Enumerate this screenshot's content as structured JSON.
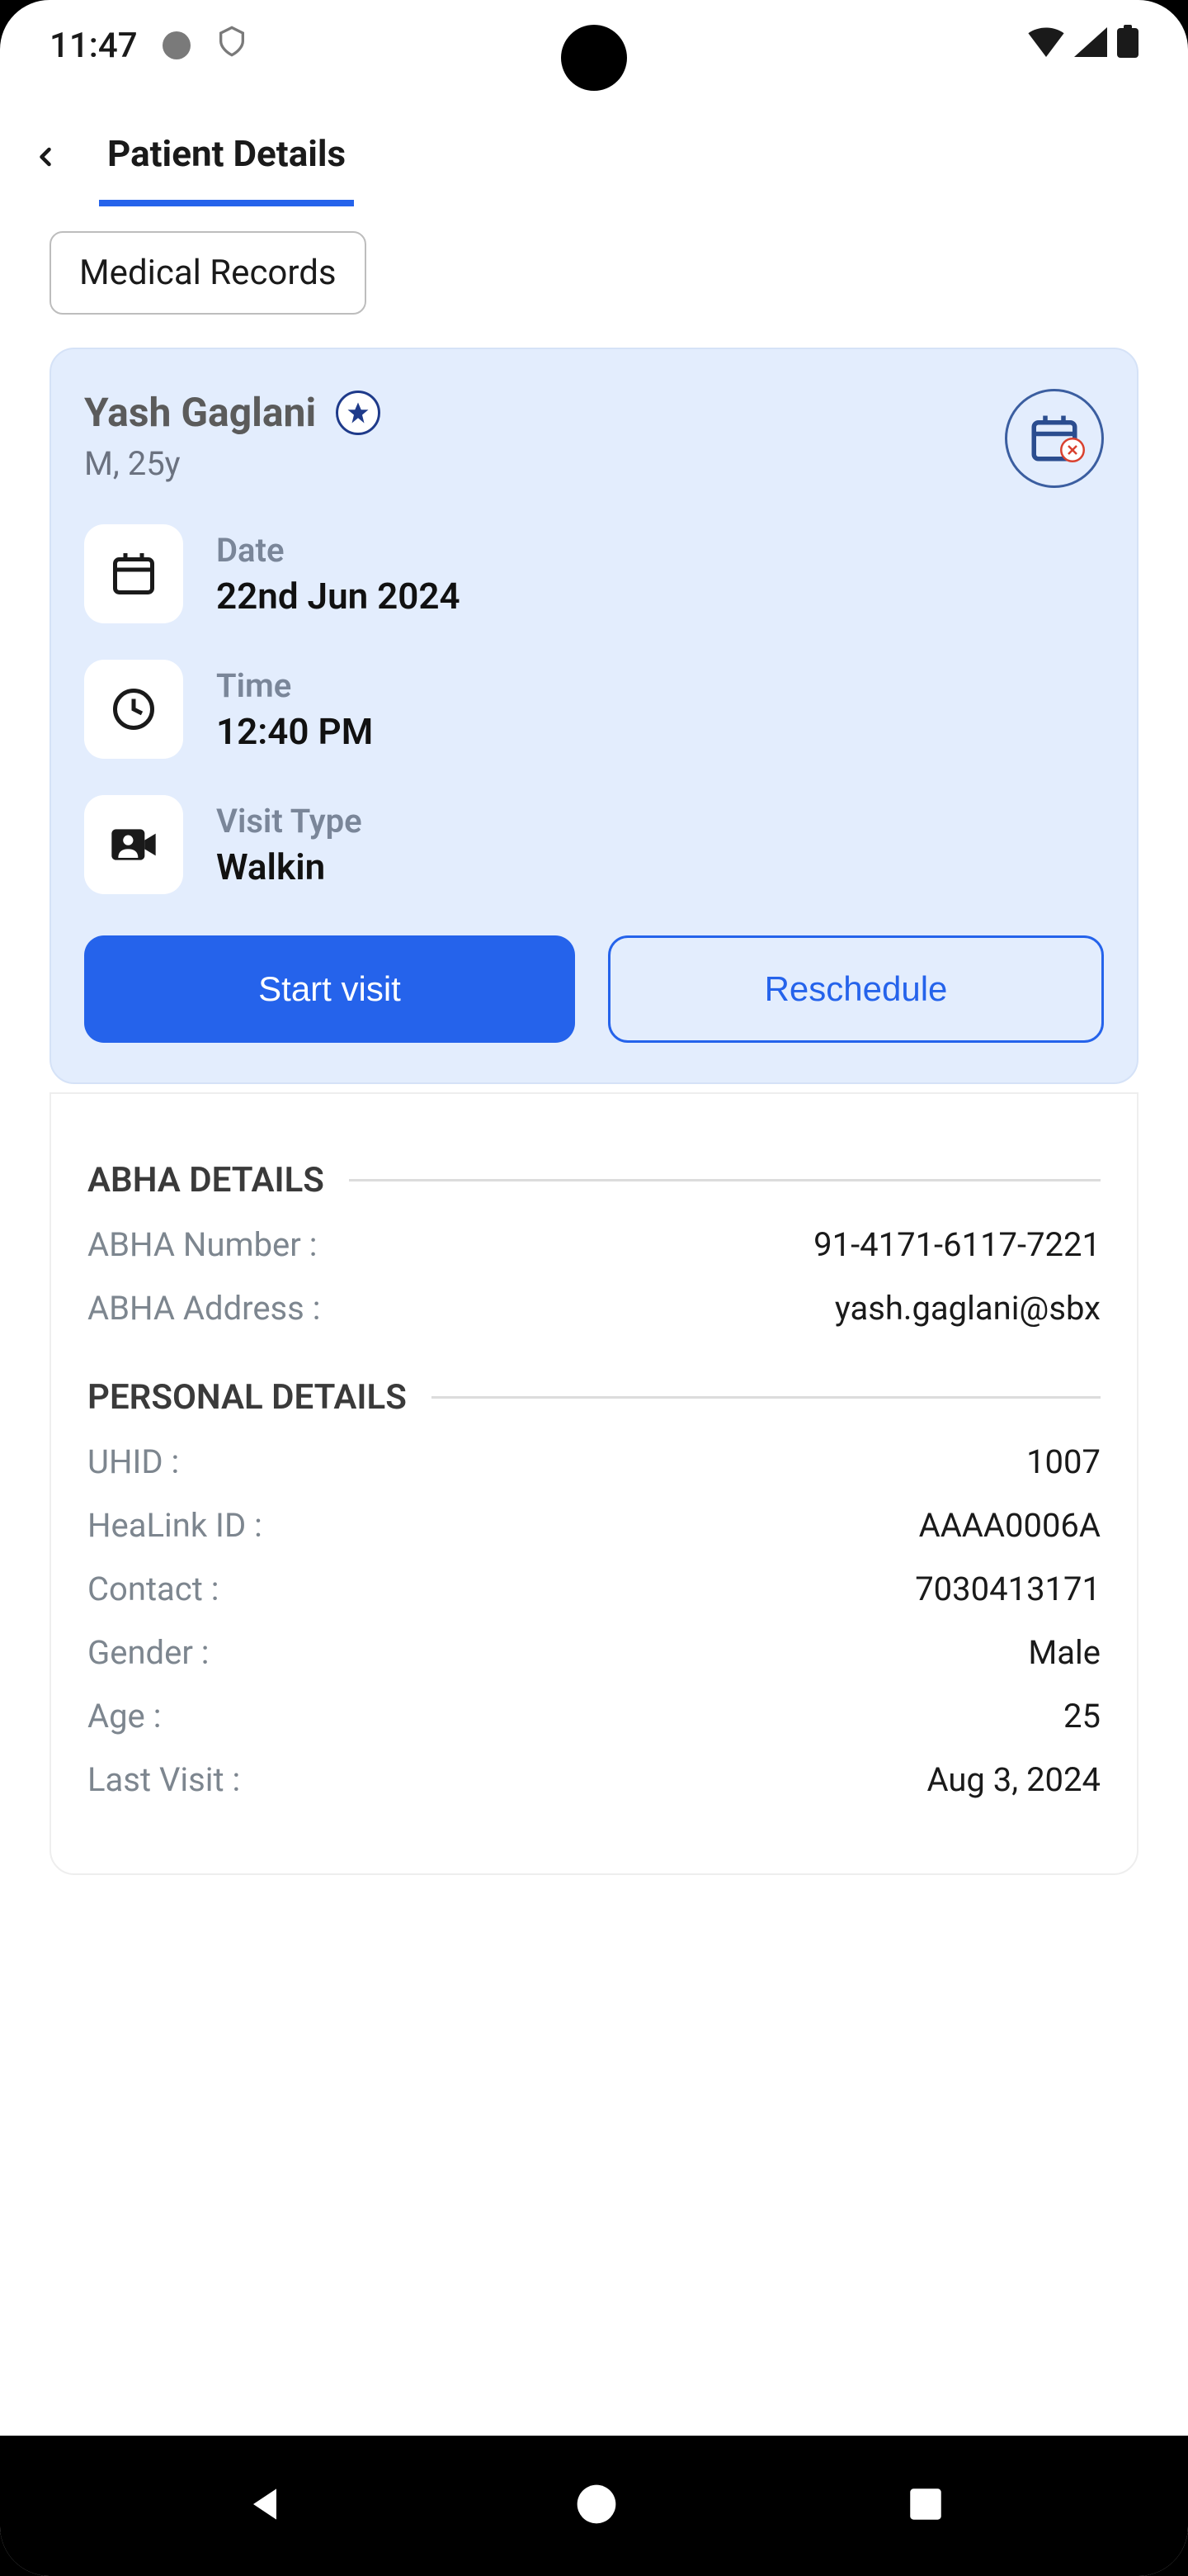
{
  "statusbar": {
    "time": "11:47"
  },
  "header": {
    "active_tab": "Patient Details"
  },
  "subnav": {
    "medical_records": "Medical Records"
  },
  "patient": {
    "name": "Yash Gaglani",
    "meta": "M, 25y"
  },
  "appointment": {
    "date_label": "Date",
    "date_value": "22nd Jun 2024",
    "time_label": "Time",
    "time_value": "12:40 PM",
    "visit_label": "Visit Type",
    "visit_value": "Walkin",
    "start_label": "Start visit",
    "reschedule_label": "Reschedule"
  },
  "abha": {
    "section_title": "ABHA DETAILS",
    "number_label": "ABHA Number :",
    "number_value": "91-4171-6117-7221",
    "address_label": "ABHA Address :",
    "address_value": "yash.gaglani@sbx"
  },
  "personal": {
    "section_title": "PERSONAL DETAILS",
    "uhid_label": "UHID :",
    "uhid_value": "1007",
    "healink_label": "HeaLink ID :",
    "healink_value": "AAAA0006A",
    "contact_label": "Contact :",
    "contact_value": "7030413171",
    "gender_label": "Gender :",
    "gender_value": "Male",
    "age_label": "Age :",
    "age_value": "25",
    "lastvisit_label": "Last Visit :",
    "lastvisit_value": "Aug 3, 2024"
  }
}
